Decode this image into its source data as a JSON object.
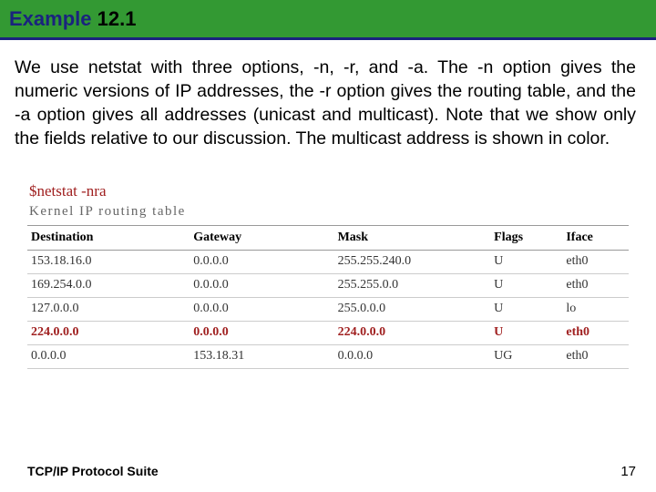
{
  "header": {
    "prefix": "Example",
    "number": "12.1"
  },
  "body": {
    "paragraph": "We use netstat with three options, -n, -r, and -a. The -n option gives the numeric versions of IP addresses, the -r option gives the routing table, and the -a option gives all addresses (unicast and multicast). Note that we show only the fields relative to our discussion. The multicast address is shown in color."
  },
  "table": {
    "command": "$netstat -nra",
    "title": "Kernel IP routing table",
    "columns": [
      "Destination",
      "Gateway",
      "Mask",
      "Flags",
      "Iface"
    ],
    "rows": [
      {
        "dest": "153.18.16.0",
        "gw": "0.0.0.0",
        "mask": "255.255.240.0",
        "flags": "U",
        "iface": "eth0",
        "multicast": false
      },
      {
        "dest": "169.254.0.0",
        "gw": "0.0.0.0",
        "mask": "255.255.0.0",
        "flags": "U",
        "iface": "eth0",
        "multicast": false
      },
      {
        "dest": "127.0.0.0",
        "gw": "0.0.0.0",
        "mask": "255.0.0.0",
        "flags": "U",
        "iface": "lo",
        "multicast": false
      },
      {
        "dest": "224.0.0.0",
        "gw": "0.0.0.0",
        "mask": "224.0.0.0",
        "flags": "U",
        "iface": "eth0",
        "multicast": true
      },
      {
        "dest": "0.0.0.0",
        "gw": "153.18.31",
        "mask": "0.0.0.0",
        "flags": "UG",
        "iface": "eth0",
        "multicast": false
      }
    ]
  },
  "footer": {
    "left": "TCP/IP Protocol Suite",
    "right": "17"
  }
}
